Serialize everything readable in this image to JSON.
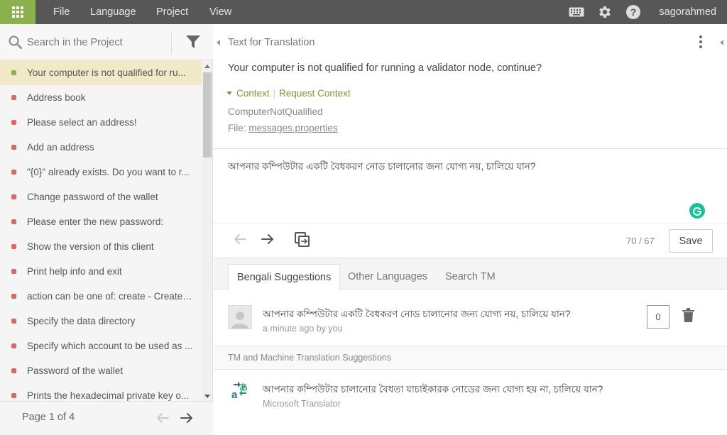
{
  "topbar": {
    "menu": [
      "File",
      "Language",
      "Project",
      "View"
    ],
    "username": "sagorahmed",
    "icons": [
      "apps-grid-icon",
      "keyboard-icon",
      "gear-icon",
      "help-icon"
    ]
  },
  "left_panel": {
    "search_placeholder": "Search in the Project",
    "items": [
      {
        "label": "Your computer is not qualified for ru...",
        "status": "translated"
      },
      {
        "label": "Address book",
        "status": "untranslated"
      },
      {
        "label": "Please select an address!",
        "status": "untranslated"
      },
      {
        "label": "Add an address",
        "status": "untranslated"
      },
      {
        "label": "\"{0}\" already exists. Do you want to r...",
        "status": "untranslated"
      },
      {
        "label": "Change password of the wallet",
        "status": "untranslated"
      },
      {
        "label": "Please enter the new password:",
        "status": "untranslated"
      },
      {
        "label": "Show the version of this client",
        "status": "untranslated"
      },
      {
        "label": "Print help info and exit",
        "status": "untranslated"
      },
      {
        "label": "action can be one of: create - Create ...",
        "status": "untranslated"
      },
      {
        "label": "Specify the data directory",
        "status": "untranslated"
      },
      {
        "label": "Specify which account to be used as ...",
        "status": "untranslated"
      },
      {
        "label": "Password of the wallet",
        "status": "untranslated"
      },
      {
        "label": "Prints the hexadecimal private key o...",
        "status": "untranslated"
      }
    ],
    "pagination": "Page 1 of 4"
  },
  "editor": {
    "title": "Text for Translation",
    "source_text": "Your computer is not qualified for running a validator node, continue?",
    "context_label": "Context",
    "request_context_label": "Request Context",
    "context_key": "ComputerNotQualified",
    "file_label": "File:",
    "file_name": "messages.properties",
    "translation": "আপনার কম্পিউটার একটি বৈধকরণ নোড চালানোর জন্য যোগ্য নয়, চালিয়ে যান?",
    "char_counter": "70 / 67",
    "save_label": "Save"
  },
  "tabs": [
    "Bengali Suggestions",
    "Other Languages",
    "Search TM"
  ],
  "suggestion": {
    "text": "আপনার কম্পিউটার একটি বৈধকরণ নোড চালানোর জন্য যোগ্য নয়, চালিয়ে যান?",
    "meta": "a minute ago by you",
    "votes": "0"
  },
  "tm_header": "TM and Machine Translation Suggestions",
  "mt_suggestion": {
    "text": "আপনার কম্পিউটার চালানোর বৈধতা যাচাইকারক নোডের জন্য যোগ্য হয় না, চালিয়ে যান?",
    "source": "Microsoft Translator"
  },
  "colors": {
    "topbar": "#575757",
    "accent_green": "#8ab14b",
    "untranslated_red": "#e06666",
    "active_row": "#f2e9c8",
    "context_green": "#7b9a33"
  }
}
